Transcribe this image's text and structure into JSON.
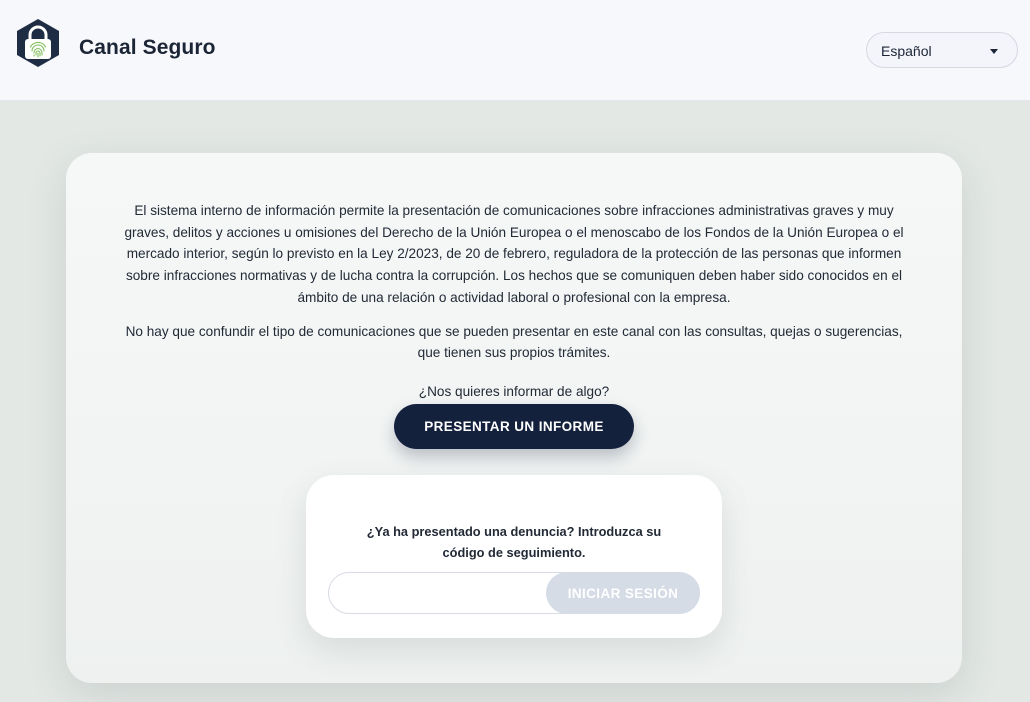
{
  "header": {
    "brand": "Canal Seguro",
    "language": {
      "selected": "Español"
    }
  },
  "main": {
    "intro_paragraphs": [
      "El sistema interno de información permite la presentación de comunicaciones sobre infracciones administrativas graves y muy graves, delitos y acciones u omisiones del Derecho de la Unión Europea o el menoscabo de los Fondos de la Unión Europea o el mercado interior, según lo previsto en la Ley 2/2023, de 20 de febrero, reguladora de la protección de las personas que informen sobre infracciones normativas y de lucha contra la corrupción. Los hechos que se comuniquen deben haber sido conocidos en el ámbito de una relación o actividad laboral o profesional con la empresa.",
      "No hay que confundir el tipo de comunicaciones que se pueden presentar en este canal con las consultas, quejas o sugerencias, que tienen sus propios trámites."
    ],
    "cta_question": "¿Nos quieres informar de algo?",
    "cta_button": "PRESENTAR UN INFORME"
  },
  "login": {
    "prompt": "¿Ya ha presentado una denuncia? Introduzca su código de seguimiento.",
    "code_value": "",
    "button": "INICIAR SESIÓN"
  },
  "icons": {
    "logo": "padlock-fingerprint-icon",
    "language_caret": "caret-down-icon"
  },
  "colors": {
    "primary": "#14213d",
    "logo_body": "#1f2d44",
    "logo_accent": "#7fbf5a",
    "disabled_button": "#d5dce6",
    "background": "#e3e8e5"
  }
}
